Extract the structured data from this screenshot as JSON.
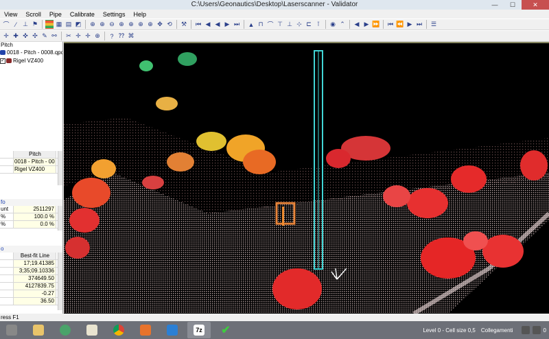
{
  "window": {
    "title": "C:\\Users\\Geonautics\\Desktop\\Laserscanner - Validator",
    "minimize": "—",
    "maximize": "☐",
    "close": "✕"
  },
  "menu": [
    "View",
    "Scroll",
    "Pipe",
    "Calibrate",
    "Settings",
    "Help"
  ],
  "tree": {
    "root": "Pitch",
    "file": "0018 - Pitch - 0008.qpd",
    "scanner": "Rigel VZ400"
  },
  "properties": {
    "header": "Pitch",
    "rows": [
      {
        "value": "0018 - Pitch - 00"
      },
      {
        "value": "Rigel VZ400"
      }
    ]
  },
  "info": {
    "label": "fo",
    "rows": [
      {
        "key": "unt",
        "value": "2511297"
      },
      {
        "key": "%",
        "value": "100.0 %"
      },
      {
        "key": "%",
        "value": "0.0 %"
      }
    ]
  },
  "fit": {
    "label": "o",
    "header": "Best-fit Line",
    "rows": [
      {
        "key": "",
        "value": "17;19.41385"
      },
      {
        "key": "",
        "value": "3;35;09.10336"
      },
      {
        "key": "",
        "value": "374649.50"
      },
      {
        "key": "",
        "value": "4127839.75"
      },
      {
        "key": "",
        "value": "-0.27"
      },
      {
        "key": "",
        "value": "36.50"
      }
    ]
  },
  "status": {
    "left": "ress F1"
  },
  "taskbar": {
    "tray_text": "Level 0 - Cell size 0,5",
    "notification": "Collegamenti",
    "time_fragment": "0"
  },
  "colors": {
    "taskbar": "#6d7078",
    "close_button": "#c75050",
    "selection_box": "#41d6d6",
    "viewport_bg": "#000000"
  }
}
